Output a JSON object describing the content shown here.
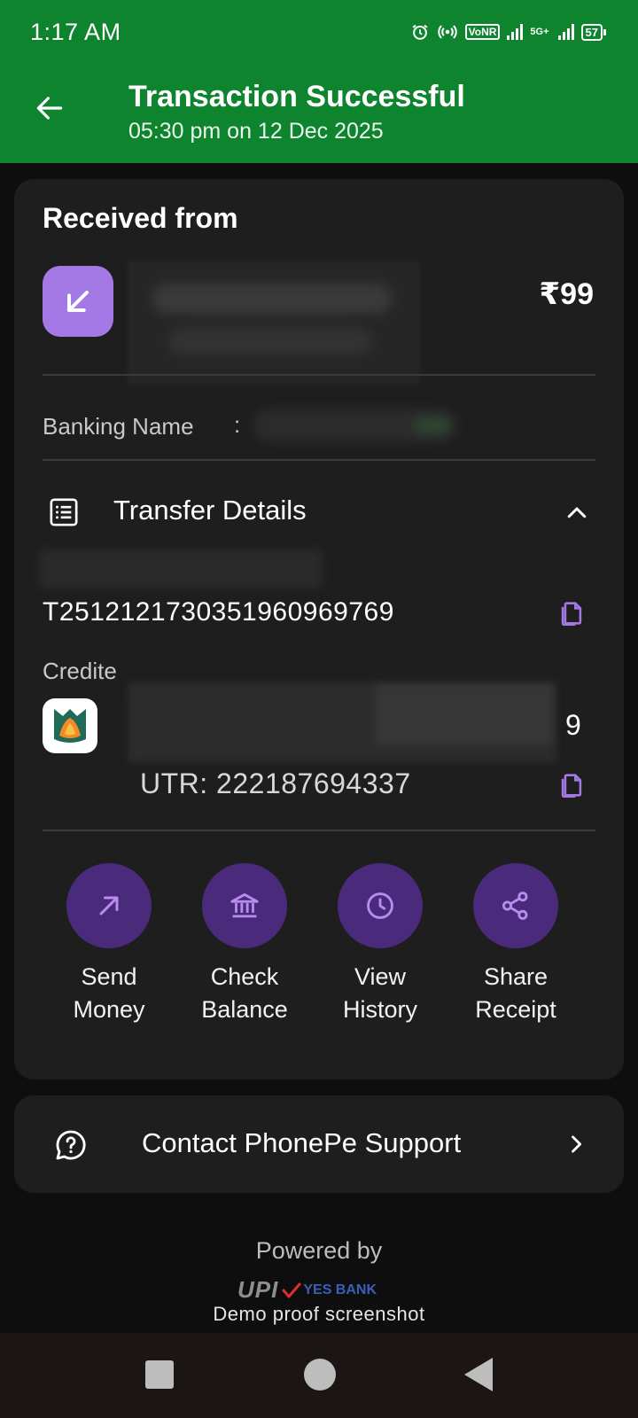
{
  "status_bar": {
    "time": "1:17 AM",
    "network_badge": "VoNR",
    "network_type": "5G+",
    "battery": "57"
  },
  "header": {
    "title": "Transaction Successful",
    "subtitle": "05:30 pm on 12 Dec 2025"
  },
  "received": {
    "label": "Received from",
    "amount": "₹99"
  },
  "banking": {
    "label": "Banking Name",
    "colon": ":"
  },
  "transfer": {
    "label": "Transfer Details",
    "transaction_id": "T2512121730351960969769",
    "credited_label": "Credite",
    "account_tail": "9",
    "utr": "UTR: 222187694337"
  },
  "actions": [
    {
      "line1": "Send",
      "line2": "Money"
    },
    {
      "line1": "Check",
      "line2": "Balance"
    },
    {
      "line1": "View",
      "line2": "History"
    },
    {
      "line1": "Share",
      "line2": "Receipt"
    }
  ],
  "support": {
    "label": "Contact PhonePe Support"
  },
  "footer": {
    "powered_by": "Powered by",
    "upi": "UPI",
    "bank": "YES BANK",
    "caption": "Demo proof screenshot"
  },
  "colors": {
    "header_green": "#0f842e",
    "card": "#1e1e1e",
    "accent_purple": "#a479e6",
    "action_circle": "#4a2a7a"
  }
}
